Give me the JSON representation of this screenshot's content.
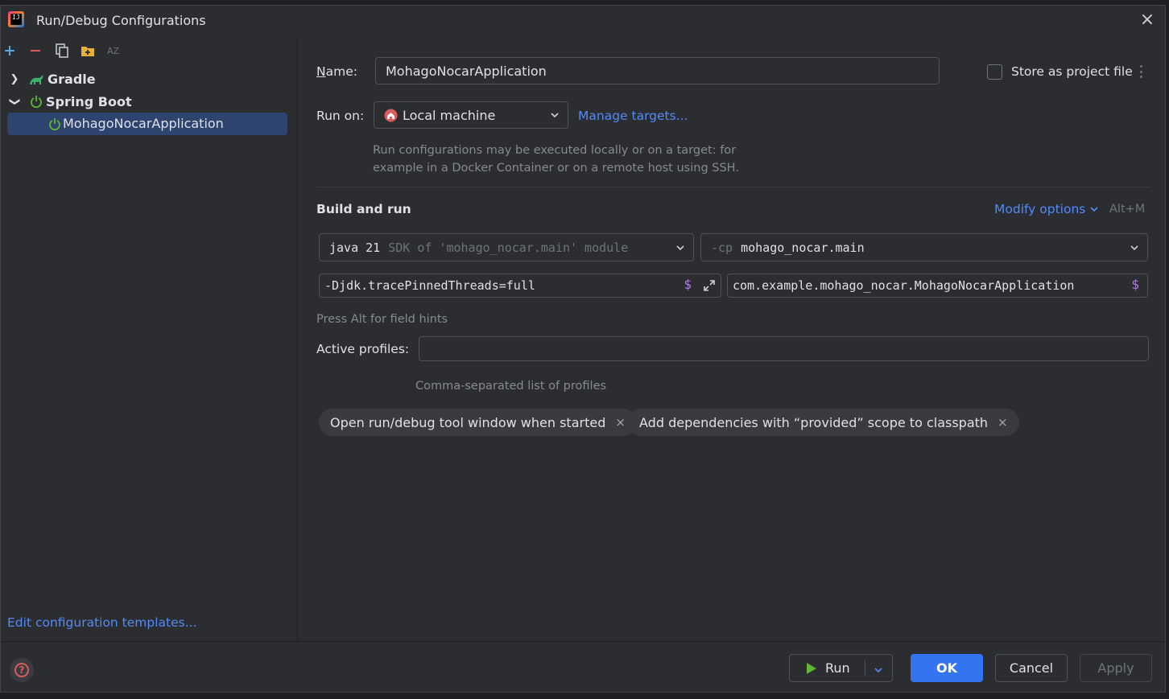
{
  "window": {
    "title": "Run/Debug Configurations"
  },
  "sidebar": {
    "tree": [
      {
        "label": "Gradle",
        "expanded": false
      },
      {
        "label": "Spring Boot",
        "expanded": true
      },
      {
        "label": "MohagoNocarApplication",
        "selected": true
      }
    ],
    "edit_templates_link": "Edit configuration templates..."
  },
  "config": {
    "name_mnemonic": "N",
    "name_label_rest": "ame:",
    "name_value": "MohagoNocarApplication",
    "store_label": "Store as project file",
    "store_checked": false,
    "run_on_label": "Run on:",
    "run_on_value": "Local machine",
    "manage_targets_link": "Manage targets...",
    "run_on_hint_line1": "Run configurations may be executed locally or on a target: for",
    "run_on_hint_line2": "example in a Docker Container or on a remote host using SSH."
  },
  "build_and_run": {
    "section_title": "Build and run",
    "modify_options_link": "Modify options",
    "modify_options_shortcut": "Alt+M",
    "jdk_main": "java 21",
    "jdk_suffix": "SDK of 'mohago_nocar.main' module",
    "cp_prefix": "-cp",
    "cp_value": "mohago_nocar.main",
    "vm_options": "-Djdk.tracePinnedThreads=full",
    "main_class": "com.example.mohago_nocar.MohagoNocarApplication",
    "field_hints": "Press Alt for field hints",
    "macro_symbol": "$"
  },
  "profiles": {
    "label": "Active profiles:",
    "value": "",
    "hint": "Comma-separated list of profiles"
  },
  "options_chips": [
    "Open run/debug tool window when started",
    "Add dependencies with “provided” scope to classpath"
  ],
  "buttons": {
    "run": "Run",
    "ok": "OK",
    "cancel": "Cancel",
    "apply": "Apply"
  },
  "colors": {
    "background": "#2b2d30",
    "accent": "#3574f0",
    "link": "#548af7",
    "selection": "#2e436e",
    "spring_green": "#5fb832",
    "macro_purple": "#b07de9"
  }
}
